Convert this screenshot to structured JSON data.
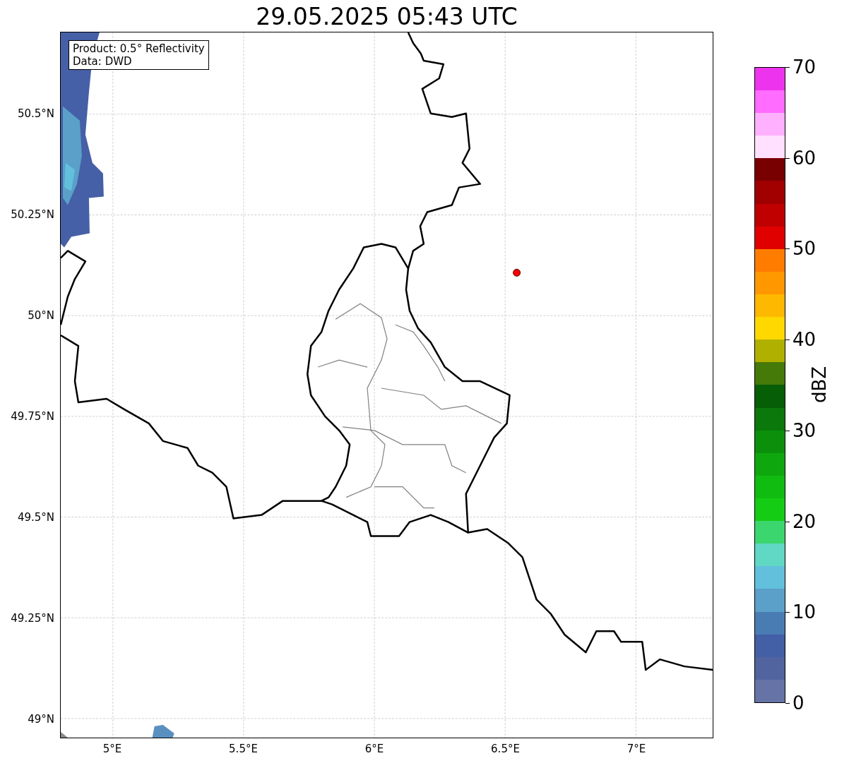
{
  "title": "29.05.2025 05:43 UTC",
  "info_box": {
    "lines": [
      "Product: 0.5° Reflectivity",
      "Data: DWD"
    ]
  },
  "y_ticks": [
    "50.5°N",
    "50.25°N",
    "50°N",
    "49.75°N",
    "49.5°N",
    "49.25°N",
    "49°N"
  ],
  "x_ticks": [
    "5°E",
    "5.5°E",
    "6°E",
    "6.5°E",
    "7°E"
  ],
  "colorbar": {
    "label": "dBZ",
    "ticks": [
      "70",
      "60",
      "50",
      "40",
      "30",
      "20",
      "10",
      "0"
    ],
    "segments": [
      {
        "color": "#6673a7"
      },
      {
        "color": "#5264a0"
      },
      {
        "color": "#435fa5"
      },
      {
        "color": "#4a7cb4"
      },
      {
        "color": "#5aa0c8"
      },
      {
        "color": "#62c0dc"
      },
      {
        "color": "#60d8c4"
      },
      {
        "color": "#3cd66e"
      },
      {
        "color": "#14cc14"
      },
      {
        "color": "#10bc10"
      },
      {
        "color": "#0ea80e"
      },
      {
        "color": "#0c900c"
      },
      {
        "color": "#0a780a"
      },
      {
        "color": "#065e06"
      },
      {
        "color": "#467a08"
      },
      {
        "color": "#b0b000"
      },
      {
        "color": "#ffd800"
      },
      {
        "color": "#ffb800"
      },
      {
        "color": "#ff9800"
      },
      {
        "color": "#ff7c00"
      },
      {
        "color": "#e00000"
      },
      {
        "color": "#c00000"
      },
      {
        "color": "#a00000"
      },
      {
        "color": "#780000"
      },
      {
        "color": "#ffe0ff"
      },
      {
        "color": "#ffb0ff"
      },
      {
        "color": "#ff6cff"
      },
      {
        "color": "#ee33ee"
      }
    ]
  }
}
